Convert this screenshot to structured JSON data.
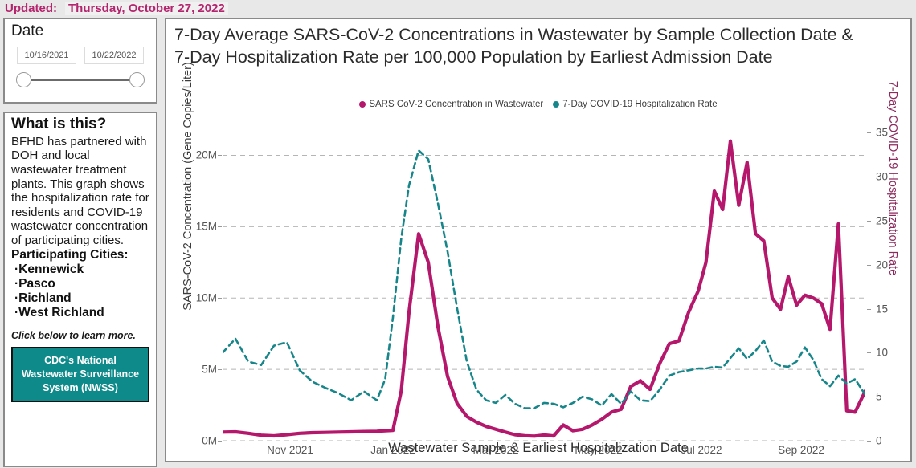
{
  "header": {
    "updated_label": "Updated:",
    "updated_value": "Thursday, October 27, 2022"
  },
  "date_panel": {
    "title": "Date",
    "start_value": "10/16/2021",
    "end_value": "10/22/2022"
  },
  "info_panel": {
    "title": "What is this?",
    "body": "BFHD has partnered with DOH and local wastewater treatment plants. This graph shows the hospitalization rate for residents and COVID-19 wastewater concentration of participating cities.",
    "cities_heading": "Participating Cities:",
    "cities": [
      "Kennewick",
      "Pasco",
      "Richland",
      "West Richland"
    ],
    "learn_more": "Click below to learn more.",
    "cdc_button": "CDC's National Wastewater Surveillance System (NWSS)"
  },
  "colors": {
    "series_wastewater": "#b4176b",
    "series_hospitalization": "#17868a",
    "accent_updated": "#b4256e",
    "cdc_button_bg": "#0e8a8a",
    "panel_border": "#8a8a8a",
    "page_background": "#e8e8e8"
  },
  "chart_data": {
    "type": "line",
    "title": "7-Day Average SARS-CoV-2 Concentrations in Wastewater by Sample Collection Date & 7-Day Hospitalization Rate per 100,000 Population by Earliest Admission Date",
    "xlabel": "Wastewater Sample & Earliest Hospitalization Date",
    "ylabel": "SARS-CoV-2 Concentration (Gene Copies/Liter)",
    "ylabel_right": "7-Day COVID-19 Hospitalization Rate",
    "grid": true,
    "legend_position": "top-center",
    "ylim": [
      0,
      22500000
    ],
    "ylim_right": [
      0,
      36.5
    ],
    "yticks": [
      0,
      5000000,
      10000000,
      15000000,
      20000000
    ],
    "ytick_labels": [
      "0M",
      "5M",
      "10M",
      "15M",
      "20M"
    ],
    "yticks_right": [
      0,
      5,
      10,
      15,
      20,
      25,
      30,
      35
    ],
    "ytick_labels_right": [
      "0",
      "5",
      "10",
      "15",
      "20",
      "25",
      "30",
      "35"
    ],
    "xticks": [
      "Nov 2021",
      "Jan 2022",
      "Mar 2022",
      "May 2022",
      "Jul 2022",
      "Sep 2022"
    ],
    "xtick_positions": [
      0.105,
      0.265,
      0.425,
      0.585,
      0.745,
      0.9
    ],
    "x_range": [
      "2021-10-16",
      "2022-10-22"
    ],
    "series": [
      {
        "name": "SARS CoV-2 Concentration in Wastewater",
        "color": "#b4176b",
        "axis": "left",
        "style": "solid",
        "units": "Gene Copies/Liter",
        "x": [
          0.0,
          0.02,
          0.04,
          0.06,
          0.08,
          0.1,
          0.12,
          0.14,
          0.16,
          0.18,
          0.2,
          0.22,
          0.24,
          0.253,
          0.265,
          0.278,
          0.29,
          0.305,
          0.32,
          0.335,
          0.35,
          0.365,
          0.38,
          0.395,
          0.41,
          0.425,
          0.44,
          0.455,
          0.47,
          0.485,
          0.5,
          0.515,
          0.53,
          0.545,
          0.56,
          0.575,
          0.59,
          0.605,
          0.62,
          0.635,
          0.65,
          0.665,
          0.68,
          0.695,
          0.71,
          0.725,
          0.74,
          0.752,
          0.765,
          0.778,
          0.79,
          0.803,
          0.816,
          0.829,
          0.842,
          0.855,
          0.868,
          0.88,
          0.893,
          0.906,
          0.919,
          0.932,
          0.945,
          0.958,
          0.971,
          0.984,
          1.0
        ],
        "y": [
          600000,
          620000,
          520000,
          380000,
          340000,
          420000,
          520000,
          560000,
          580000,
          600000,
          620000,
          640000,
          660000,
          700000,
          720000,
          3500000,
          9000000,
          14500000,
          12500000,
          8000000,
          4500000,
          2600000,
          1700000,
          1300000,
          1000000,
          800000,
          600000,
          420000,
          350000,
          320000,
          400000,
          330000,
          1100000,
          700000,
          800000,
          1100000,
          1500000,
          2000000,
          2200000,
          3800000,
          4200000,
          3600000,
          5400000,
          6800000,
          7000000,
          9000000,
          10500000,
          12500000,
          17500000,
          16200000,
          21000000,
          16500000,
          19500000,
          14500000,
          14000000,
          10000000,
          9200000,
          11500000,
          9500000,
          10200000,
          10000000,
          9600000,
          7800000,
          15200000,
          2100000,
          2000000,
          3500000
        ]
      },
      {
        "name": "7-Day COVID-19 Hospitalization Rate",
        "color": "#17868a",
        "axis": "right",
        "style": "dashed",
        "units": "per 100,000 population",
        "x": [
          0.0,
          0.02,
          0.04,
          0.06,
          0.08,
          0.1,
          0.12,
          0.14,
          0.16,
          0.18,
          0.2,
          0.22,
          0.24,
          0.253,
          0.265,
          0.278,
          0.29,
          0.305,
          0.32,
          0.335,
          0.35,
          0.365,
          0.38,
          0.395,
          0.41,
          0.425,
          0.44,
          0.455,
          0.47,
          0.485,
          0.5,
          0.515,
          0.53,
          0.545,
          0.56,
          0.575,
          0.59,
          0.605,
          0.62,
          0.635,
          0.65,
          0.665,
          0.68,
          0.695,
          0.71,
          0.725,
          0.74,
          0.752,
          0.765,
          0.778,
          0.79,
          0.803,
          0.816,
          0.829,
          0.842,
          0.855,
          0.868,
          0.88,
          0.893,
          0.906,
          0.919,
          0.932,
          0.945,
          0.958,
          0.971,
          0.984,
          1.0
        ],
        "y": [
          10.0,
          11.6,
          9.0,
          8.6,
          10.8,
          11.2,
          8.0,
          6.7,
          6.0,
          5.4,
          4.6,
          5.6,
          4.6,
          7.0,
          14.0,
          23.0,
          29.0,
          33.0,
          32.0,
          27.0,
          21.5,
          15.0,
          9.0,
          5.8,
          4.6,
          4.3,
          5.2,
          4.2,
          3.7,
          3.7,
          4.3,
          4.2,
          3.8,
          4.3,
          5.0,
          4.7,
          4.0,
          5.3,
          4.2,
          5.6,
          4.6,
          4.5,
          5.8,
          7.4,
          7.8,
          8.0,
          8.2,
          8.2,
          8.4,
          8.3,
          9.4,
          10.5,
          9.3,
          10.2,
          11.4,
          9.0,
          8.5,
          8.4,
          9.0,
          10.6,
          9.2,
          7.0,
          6.2,
          7.4,
          6.5,
          7.0,
          5.2,
          4.0,
          3.5
        ]
      }
    ]
  }
}
